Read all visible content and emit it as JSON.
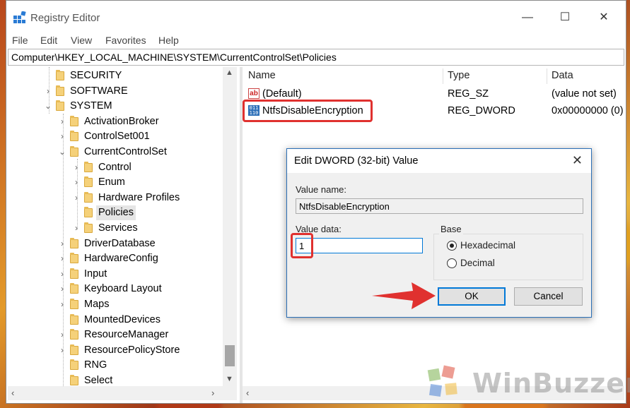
{
  "window": {
    "title": "Registry Editor",
    "controls": {
      "minimize": "—",
      "maximize": "☐",
      "close": "✕"
    }
  },
  "menu": [
    "File",
    "Edit",
    "View",
    "Favorites",
    "Help"
  ],
  "address": "Computer\\HKEY_LOCAL_MACHINE\\SYSTEM\\CurrentControlSet\\Policies",
  "tree": [
    {
      "label": "SECURITY",
      "chevron": ""
    },
    {
      "label": "SOFTWARE",
      "chevron": "›"
    },
    {
      "label": "SYSTEM",
      "chevron": "⌄"
    },
    {
      "label": "ActivationBroker",
      "chevron": "›"
    },
    {
      "label": "ControlSet001",
      "chevron": "›"
    },
    {
      "label": "CurrentControlSet",
      "chevron": "⌄"
    },
    {
      "label": "Control",
      "chevron": "›"
    },
    {
      "label": "Enum",
      "chevron": "›"
    },
    {
      "label": "Hardware Profiles",
      "chevron": "›"
    },
    {
      "label": "Policies",
      "chevron": ""
    },
    {
      "label": "Services",
      "chevron": "›"
    },
    {
      "label": "DriverDatabase",
      "chevron": "›"
    },
    {
      "label": "HardwareConfig",
      "chevron": "›"
    },
    {
      "label": "Input",
      "chevron": "›"
    },
    {
      "label": "Keyboard Layout",
      "chevron": "›"
    },
    {
      "label": "Maps",
      "chevron": "›"
    },
    {
      "label": "MountedDevices",
      "chevron": ""
    },
    {
      "label": "ResourceManager",
      "chevron": "›"
    },
    {
      "label": "ResourcePolicyStore",
      "chevron": "›"
    },
    {
      "label": "RNG",
      "chevron": ""
    },
    {
      "label": "Select",
      "chevron": ""
    }
  ],
  "values_table": {
    "headers": [
      "Name",
      "Type",
      "Data"
    ],
    "rows": [
      {
        "icon": "ab",
        "name": "(Default)",
        "type": "REG_SZ",
        "data": "(value not set)"
      },
      {
        "icon": "binary",
        "name": "NtfsDisableEncryption",
        "type": "REG_DWORD",
        "data": "0x00000000 (0)"
      }
    ]
  },
  "dialog": {
    "title": "Edit DWORD (32-bit) Value",
    "value_name_label": "Value name:",
    "value_name": "NtfsDisableEncryption",
    "value_data_label": "Value data:",
    "value_data": "1",
    "base_label": "Base",
    "radio_hex": "Hexadecimal",
    "radio_dec": "Decimal",
    "selected_base": "Hexadecimal",
    "ok": "OK",
    "cancel": "Cancel"
  },
  "annotation_colors": {
    "highlight": "#e0312f",
    "arrow": "#e0312f"
  },
  "watermark": "WinBuzzer"
}
